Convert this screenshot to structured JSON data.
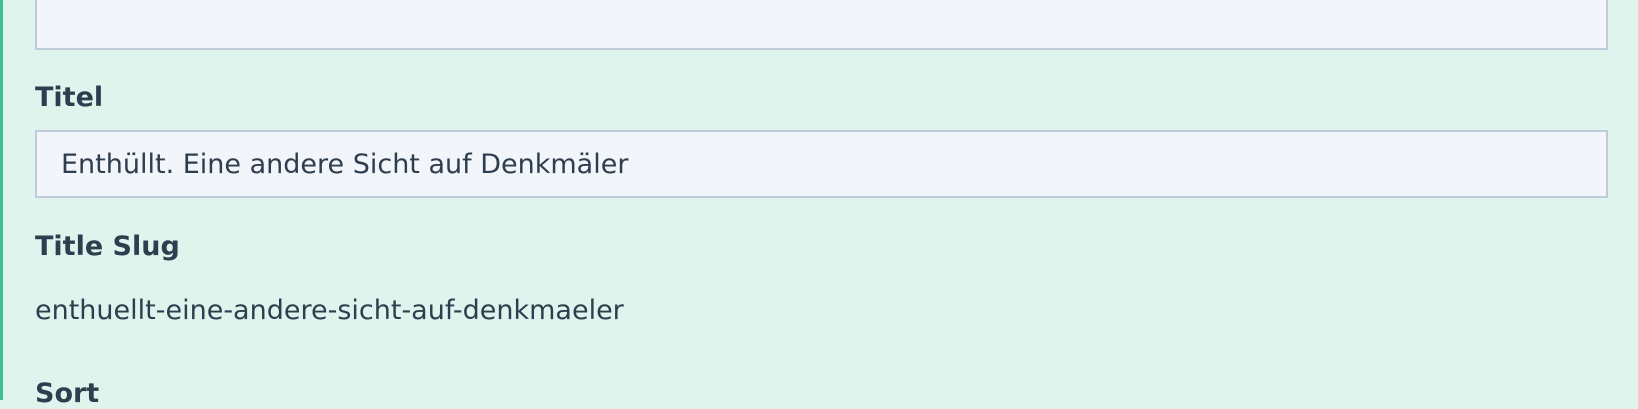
{
  "form": {
    "previous_field": {
      "value": ""
    },
    "titel": {
      "label": "Titel",
      "value": "Enthüllt. Eine andere Sicht auf Denkmäler"
    },
    "title_slug": {
      "label": "Title Slug",
      "value": "enthuellt-eine-andere-sicht-auf-denkmaeler"
    },
    "sort": {
      "label": "Sort"
    }
  },
  "colors": {
    "panel_background": "#e0f4ee",
    "panel_accent_border": "#3dbf8f",
    "input_background": "#f2f5fa",
    "input_border": "#c0cad8",
    "text": "#2f3e4e"
  }
}
